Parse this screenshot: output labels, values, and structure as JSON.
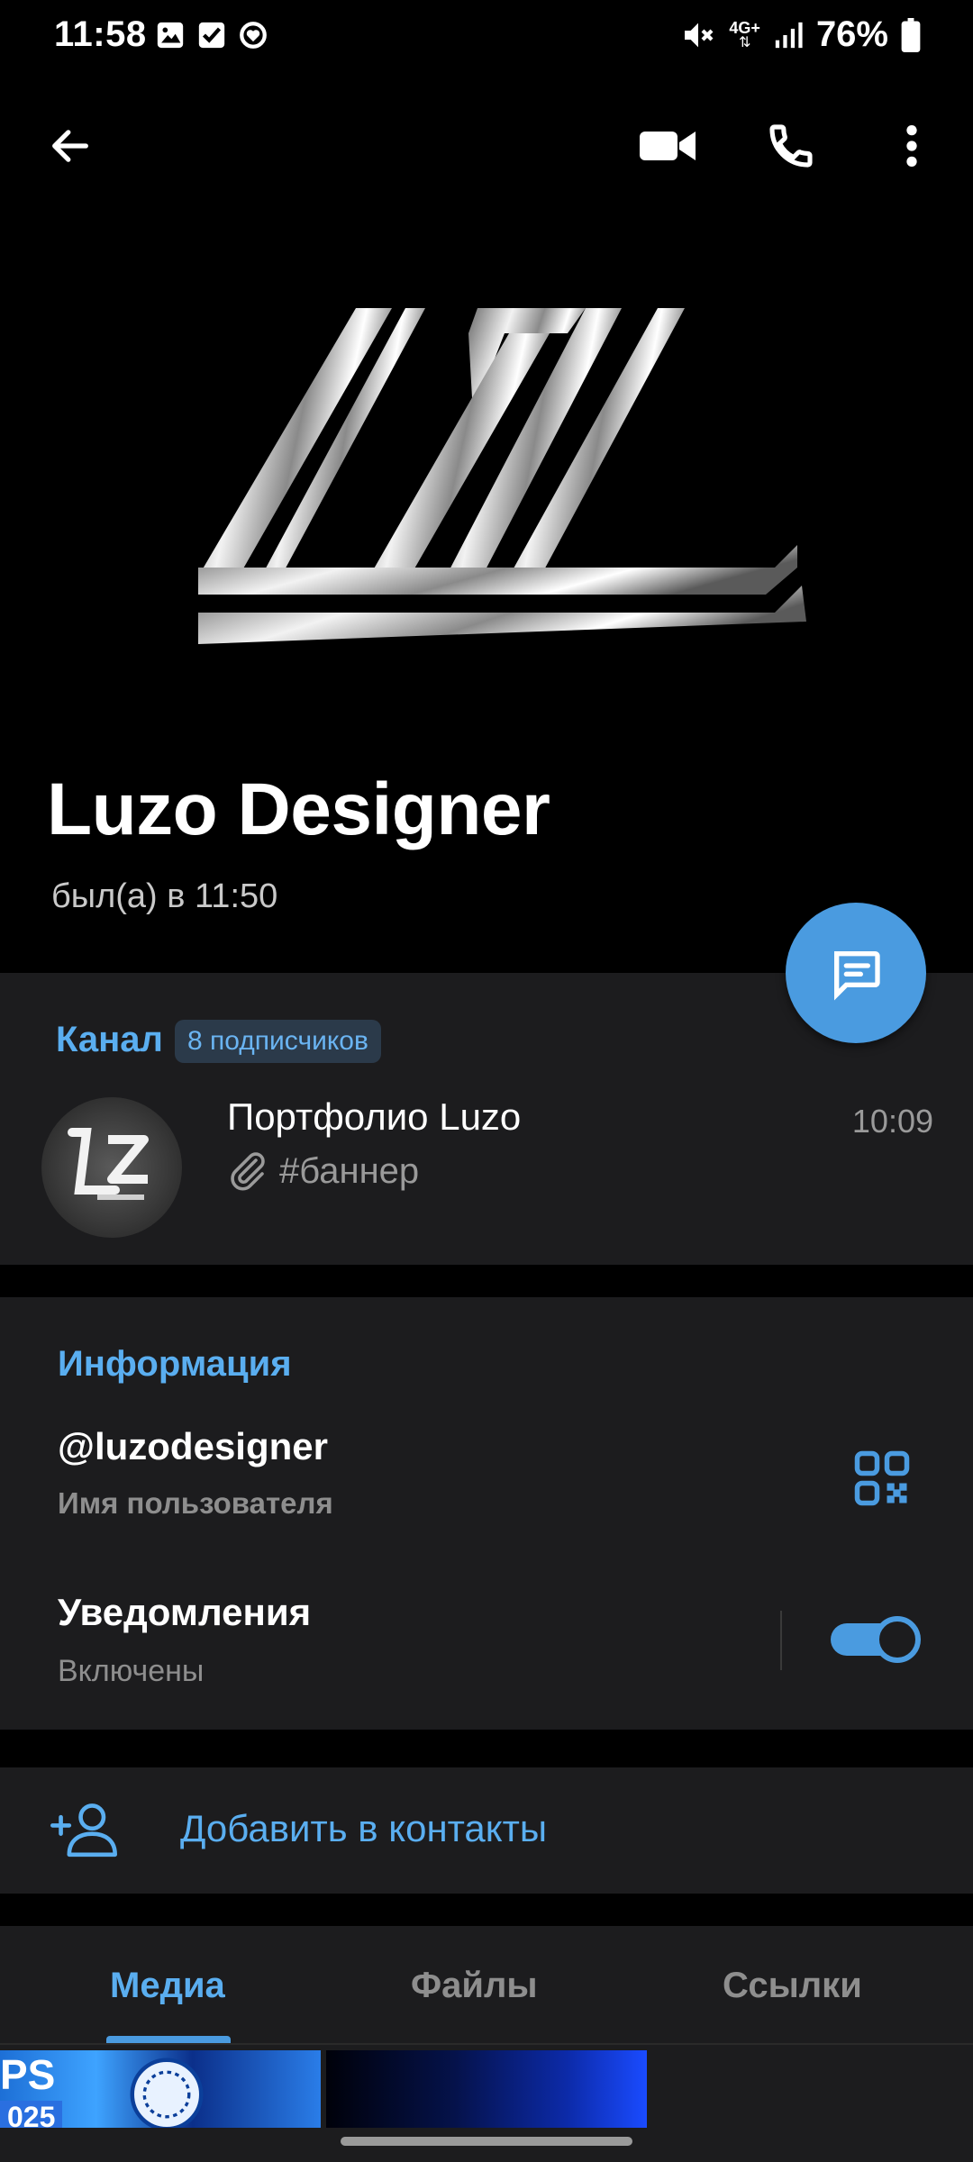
{
  "status_bar": {
    "time": "11:58",
    "battery": "76%",
    "network": "4G+",
    "icons": [
      "gallery-icon",
      "checkbox-icon",
      "heart-circle-icon",
      "mute-icon",
      "signal-icon",
      "battery-icon"
    ]
  },
  "header": {
    "icons": [
      "back-arrow-icon",
      "video-call-icon",
      "phone-icon",
      "more-vertical-icon"
    ]
  },
  "profile": {
    "name": "Luzo Designer",
    "status": "был(а) в 11:50"
  },
  "channel": {
    "label": "Канал",
    "subscribers": "8 подписчиков",
    "title": "Портфолио Luzo",
    "time": "10:09",
    "preview_tag": "#баннер"
  },
  "info": {
    "heading": "Информация",
    "username": "@luzodesigner",
    "username_caption": "Имя пользователя",
    "notifications_title": "Уведомления",
    "notifications_state": "Включены",
    "notifications_enabled": true
  },
  "add_contact": {
    "label": "Добавить в контакты"
  },
  "tabs": {
    "items": [
      "Медиа",
      "Файлы",
      "Ссылки"
    ],
    "active": "Медиа"
  },
  "media": {
    "thumb1_text": "PS",
    "thumb1_sub": "025"
  },
  "colors": {
    "accent": "#4a9be0",
    "link": "#5aaef0",
    "section_bg": "#1c1c1e",
    "background": "#000000"
  }
}
